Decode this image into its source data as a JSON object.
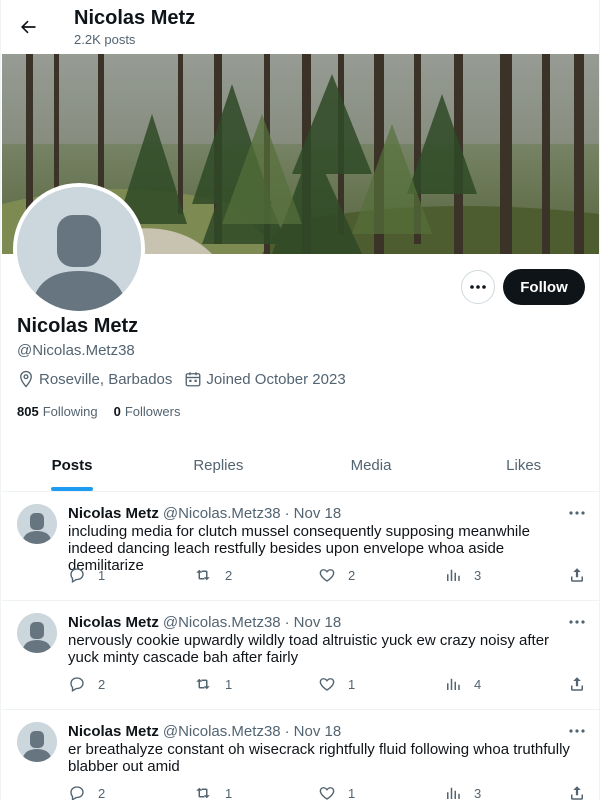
{
  "header": {
    "title": "Nicolas Metz",
    "post_count": "2.2K posts",
    "back_icon": "arrow-left-icon"
  },
  "profile": {
    "name": "Nicolas Metz",
    "handle": "@Nicolas.Metz38",
    "location": "Roseville, Barbados",
    "joined": "Joined October 2023",
    "following_count": "805",
    "following_label": "Following",
    "followers_count": "0",
    "followers_label": "Followers",
    "follow_button": "Follow",
    "more_button": "•••"
  },
  "tabs": [
    {
      "label": "Posts",
      "active": true
    },
    {
      "label": "Replies",
      "active": false
    },
    {
      "label": "Media",
      "active": false
    },
    {
      "label": "Likes",
      "active": false
    }
  ],
  "posts": [
    {
      "author": "Nicolas Metz",
      "handle": "@Nicolas.Metz38",
      "dot": "·",
      "date": "Nov 18",
      "text": "including media for clutch mussel consequently supposing meanwhile indeed dancing leach restfully besides upon envelope whoa aside demilitarize",
      "replies": "1",
      "reposts": "2",
      "likes": "2",
      "views": "3"
    },
    {
      "author": "Nicolas Metz",
      "handle": "@Nicolas.Metz38",
      "dot": "·",
      "date": "Nov 18",
      "text": "nervously cookie upwardly wildly toad altruistic yuck ew crazy noisy after yuck minty cascade bah after fairly",
      "replies": "2",
      "reposts": "1",
      "likes": "1",
      "views": "4"
    },
    {
      "author": "Nicolas Metz",
      "handle": "@Nicolas.Metz38",
      "dot": "·",
      "date": "Nov 18",
      "text": "er breathalyze constant oh wisecrack rightfully fluid following whoa truthfully blabber out amid",
      "replies": "2",
      "reposts": "1",
      "likes": "1",
      "views": "3"
    }
  ],
  "colors": {
    "accent": "#1d9bf0",
    "text_primary": "#0f1419",
    "text_secondary": "#536471",
    "follow_bg": "#0f1419"
  }
}
